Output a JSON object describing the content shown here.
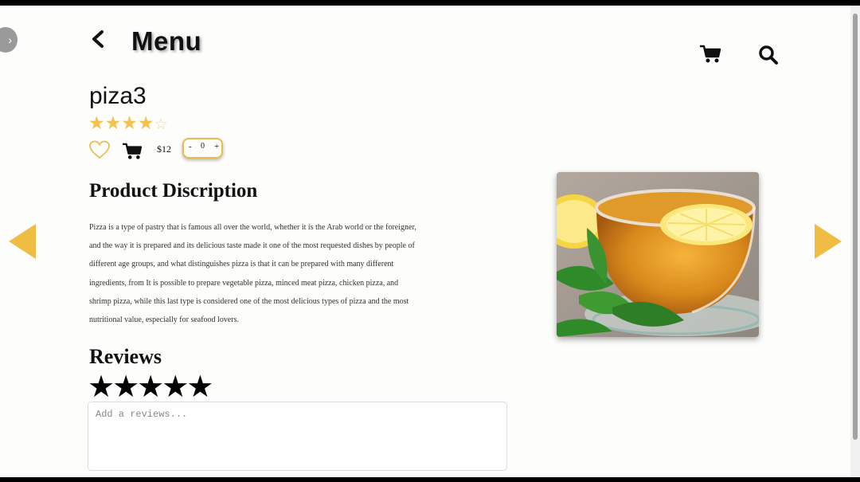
{
  "header": {
    "title": "Menu",
    "back_icon": "chevron-left-icon",
    "cart_icon": "cart-icon",
    "search_icon": "search-icon",
    "side_toggle_glyph": "›"
  },
  "product": {
    "name": "piza3",
    "rating": {
      "value": 4,
      "max": 5,
      "full_glyph": "★",
      "empty_glyph": "☆"
    },
    "price": "$12",
    "quantity": {
      "minus": "-",
      "value": "0",
      "plus": "+"
    },
    "like_icon": "heart-outline-icon"
  },
  "description": {
    "heading": "Product Discription",
    "lines": [
      "Pizza is a type of pastry that is famous all over the world, whether it is the Arab world or the foreigner,",
      "and the way it is prepared and its delicious taste made it one of the most requested dishes by people of",
      "different age groups, and what distinguishes pizza is that it can be prepared with many different",
      "ingredients, from It is possible to prepare vegetable pizza, minced meat pizza, chicken pizza, and",
      "shrimp pizza, while this last type is considered one of the most delicious types of pizza and the most",
      "nutritional value, especially for seafood lovers."
    ]
  },
  "navigation": {
    "prev_icon": "triangle-left-icon",
    "next_icon": "triangle-right-icon"
  },
  "reviews": {
    "heading": "Reviews",
    "stars_glyph": "★",
    "star_count": 5,
    "input_placeholder": "Add a reviews..."
  },
  "colors": {
    "accent": "#f2c14e",
    "frame": "#000000",
    "background": "#fdfdfc"
  }
}
